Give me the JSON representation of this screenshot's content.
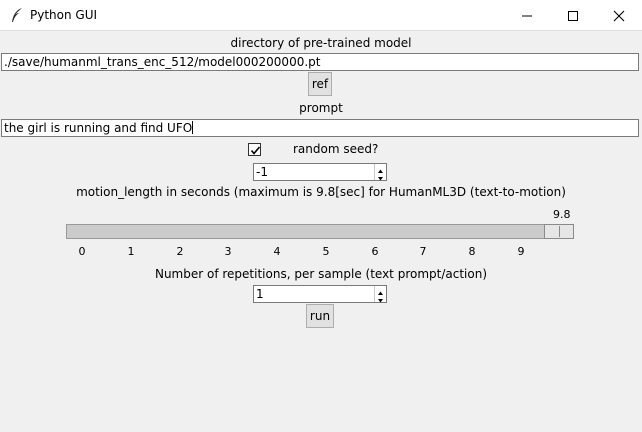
{
  "window": {
    "title": "Python GUI",
    "icons": {
      "app": "feather-icon",
      "minimize": "minimize-icon",
      "maximize": "maximize-icon",
      "close": "close-icon"
    }
  },
  "model": {
    "label": "directory of pre-trained model",
    "path": "./save/humanml_trans_enc_512/model000200000.pt",
    "ref_button": "ref"
  },
  "prompt": {
    "label": "prompt",
    "value": "the girl is running and find UFO"
  },
  "seed": {
    "checkbox_label": "random seed?",
    "checked": true,
    "value": "-1"
  },
  "motion_length": {
    "label": "motion_length in seconds (maximum is 9.8[sec] for HumanML3D (text-to-motion)",
    "value": "9.8",
    "level": 9.8,
    "max": 9.8,
    "ticks": [
      "0",
      "1",
      "2",
      "3",
      "4",
      "5",
      "6",
      "7",
      "8",
      "9"
    ]
  },
  "repetitions": {
    "label": "Number of repetitions, per sample (text prompt/action)",
    "value": "1"
  },
  "run_button": "run"
}
